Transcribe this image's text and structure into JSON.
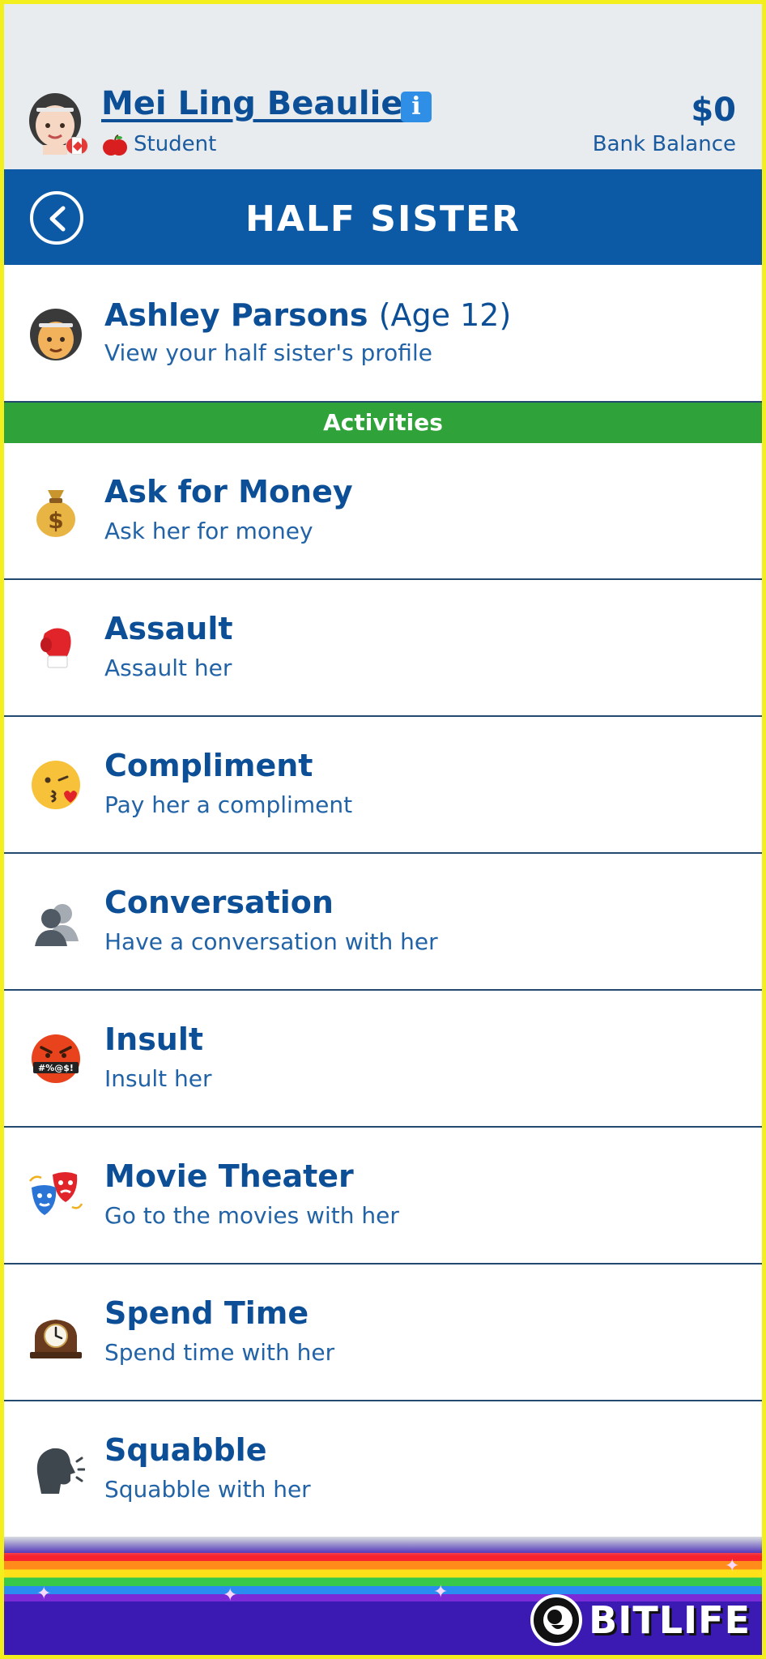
{
  "header": {
    "player_name": "Mei Ling Beaulieu",
    "occupation": "Student",
    "bank_amount": "$0",
    "bank_label": "Bank Balance"
  },
  "titlebar": {
    "title": "HALF SISTER"
  },
  "sibling": {
    "name": "Ashley Parsons",
    "age": "(Age 12)",
    "subtitle": "View your half sister's profile"
  },
  "section": {
    "label": "Activities"
  },
  "activities": [
    {
      "title": "Ask for Money",
      "subtitle": "Ask her for money",
      "icon": "money-bag-icon"
    },
    {
      "title": "Assault",
      "subtitle": "Assault her",
      "icon": "boxing-glove-icon"
    },
    {
      "title": "Compliment",
      "subtitle": "Pay her a compliment",
      "icon": "kissing-face-icon"
    },
    {
      "title": "Conversation",
      "subtitle": "Have a conversation with her",
      "icon": "two-people-silhouette-icon"
    },
    {
      "title": "Insult",
      "subtitle": "Insult her",
      "icon": "cursing-face-icon"
    },
    {
      "title": "Movie Theater",
      "subtitle": "Go to the movies with her",
      "icon": "theater-masks-icon"
    },
    {
      "title": "Spend Time",
      "subtitle": "Spend time with her",
      "icon": "mantel-clock-icon"
    },
    {
      "title": "Squabble",
      "subtitle": "Squabble with her",
      "icon": "speaking-head-icon"
    }
  ],
  "footer": {
    "brand": "BITLIFE"
  },
  "colors": {
    "header_bg": "#e8ecef",
    "titlebar_bg": "#0c5aa6",
    "section_bg": "#2fa23a",
    "text_blue": "#0d4f96",
    "frame_yellow": "#f3ef1f"
  }
}
